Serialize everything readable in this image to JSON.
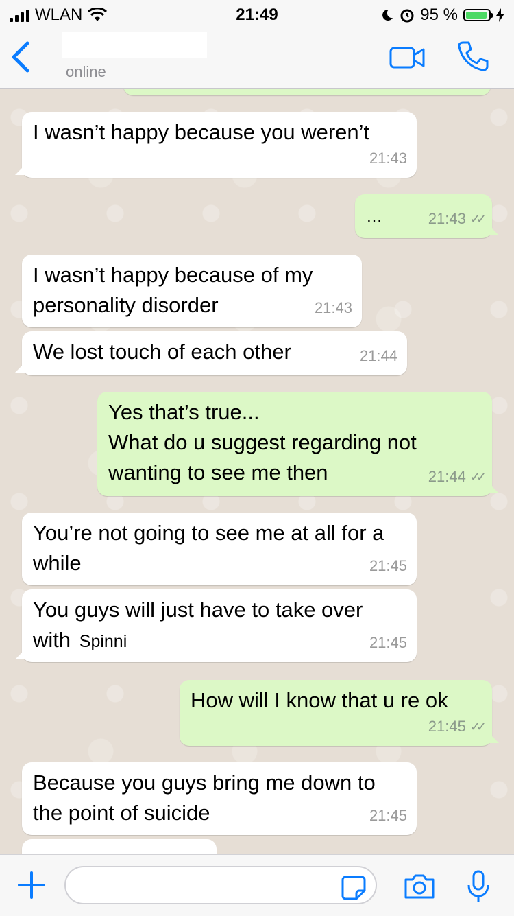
{
  "status_bar": {
    "carrier": "WLAN",
    "time": "21:49",
    "battery_percent": "95 %",
    "battery_level": 0.95
  },
  "header": {
    "contact_status": "online"
  },
  "messages": [
    {
      "direction": "in",
      "text": "I wasn’t happy because you weren’t",
      "time": "21:43"
    },
    {
      "direction": "out",
      "text": "…",
      "time": "21:43",
      "ticks": "✓✓"
    },
    {
      "direction": "in",
      "text": "I wasn’t happy because of my personality disorder",
      "time": "21:43"
    },
    {
      "direction": "in",
      "text": "We lost touch of each other",
      "time": "21:44"
    },
    {
      "direction": "out",
      "lines": [
        "Yes that’s true...",
        "What do u suggest regarding not",
        "wanting to see me then"
      ],
      "time": "21:44",
      "ticks": "✓✓"
    },
    {
      "direction": "in",
      "text": "You’re not going to see me at all for a while",
      "time": "21:45"
    },
    {
      "direction": "in",
      "text": "You guys will just have to take over with",
      "mention": "Spinni",
      "time": "21:45"
    },
    {
      "direction": "out",
      "text": "How will I know that u re ok",
      "time": "21:45",
      "ticks": "✓✓"
    },
    {
      "direction": "in",
      "text": "Because you guys bring me down to the point of suicide",
      "time": "21:45"
    }
  ],
  "colors": {
    "accent": "#0a7cff",
    "incoming": "#ffffff",
    "outgoing": "#dcf8c6",
    "background": "#e6ded5"
  },
  "icons": [
    "back-chevron-icon",
    "video-call-icon",
    "phone-call-icon",
    "plus-icon",
    "sticker-icon",
    "camera-icon",
    "microphone-icon"
  ]
}
